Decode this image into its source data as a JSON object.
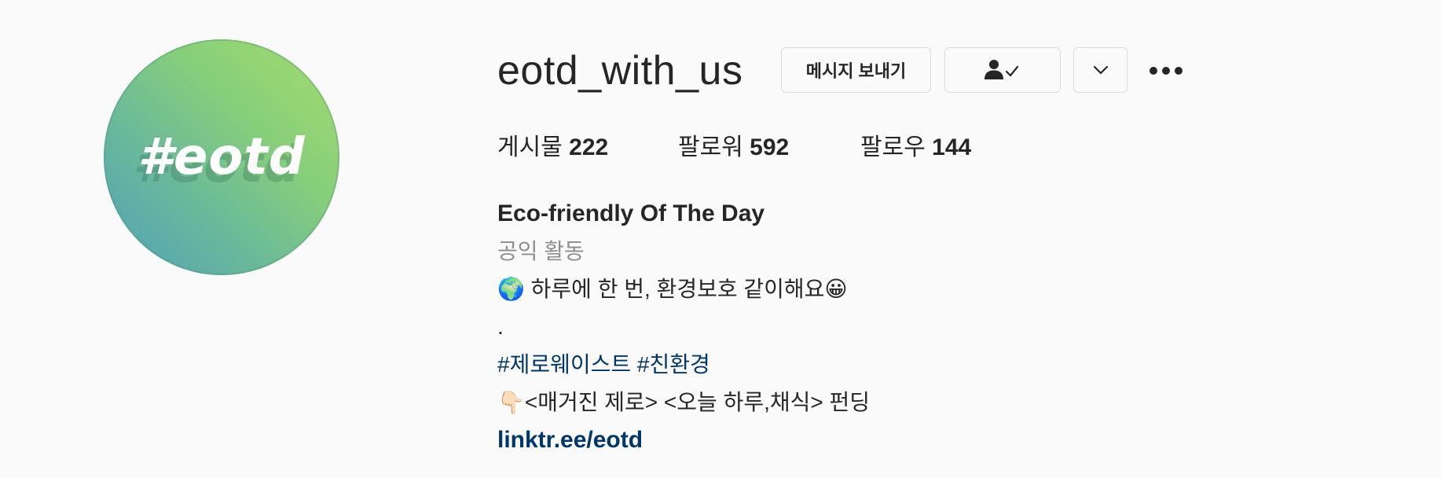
{
  "profile": {
    "username": "eotd_with_us",
    "avatar_text": "#eotd",
    "avatar_colors": [
      "#a6dc6c",
      "#4fa0ba"
    ]
  },
  "actions": {
    "message_label": "메시지 보내기",
    "following_icon": "person-check-icon",
    "suggest_icon": "chevron-down-icon",
    "more_icon": "more-horizontal-icon"
  },
  "stats": {
    "posts_label": "게시물",
    "posts_count": "222",
    "followers_label": "팔로워",
    "followers_count": "592",
    "following_label": "팔로우",
    "following_count": "144"
  },
  "bio": {
    "name": "Eco-friendly Of The Day",
    "category": "공익 활동",
    "line1": "🌍 하루에 한 번, 환경보호 같이해요😀",
    "line2": ".",
    "hashtag1": "#제로웨이스트",
    "hashtag2": "#친환경",
    "line4": "👇🏻<매거진 제로> <오늘 하루,채식> 펀딩",
    "link": "linktr.ee/eotd"
  },
  "colors": {
    "link": "#00376b",
    "secondary_text": "#8e8e8e",
    "border": "#dbdbdb"
  }
}
